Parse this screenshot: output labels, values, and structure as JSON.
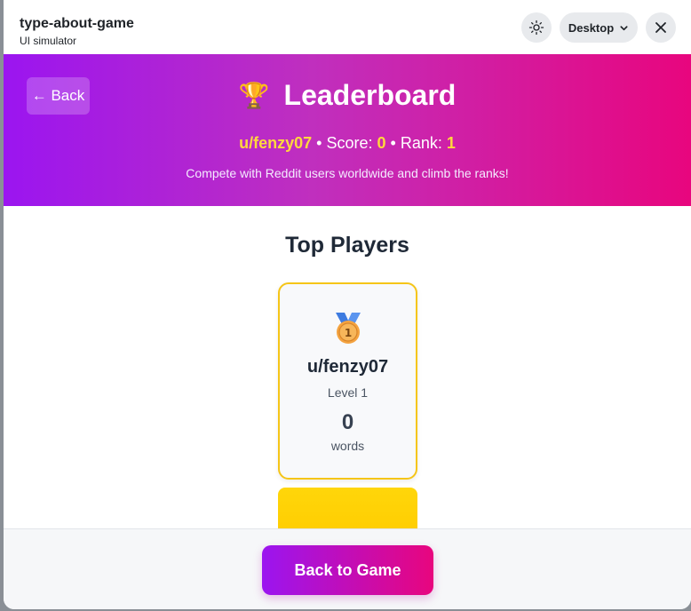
{
  "titlebar": {
    "app_name": "type-about-game",
    "app_subtitle": "UI simulator",
    "device_select": "Desktop"
  },
  "hero": {
    "back_label": "← Back",
    "title_icon": "🏆",
    "title": "Leaderboard",
    "username": "u/fenzy07",
    "score_label": "Score:",
    "score": "0",
    "rank_label": "Rank:",
    "rank": "1",
    "sep": "•",
    "subtitle": "Compete with Reddit users worldwide and climb the ranks!"
  },
  "main": {
    "section_title": "Top Players",
    "players": [
      {
        "medal_icon": "gold-medal-icon",
        "name": "u/fenzy07",
        "level": "Level 1",
        "words": "0",
        "words_label": "words"
      }
    ]
  },
  "footer": {
    "back_to_game": "Back to Game"
  },
  "colors": {
    "accent_start": "#9b15f0",
    "accent_end": "#e8067e",
    "highlight": "#ffd83d",
    "card_border": "#f5c518"
  }
}
